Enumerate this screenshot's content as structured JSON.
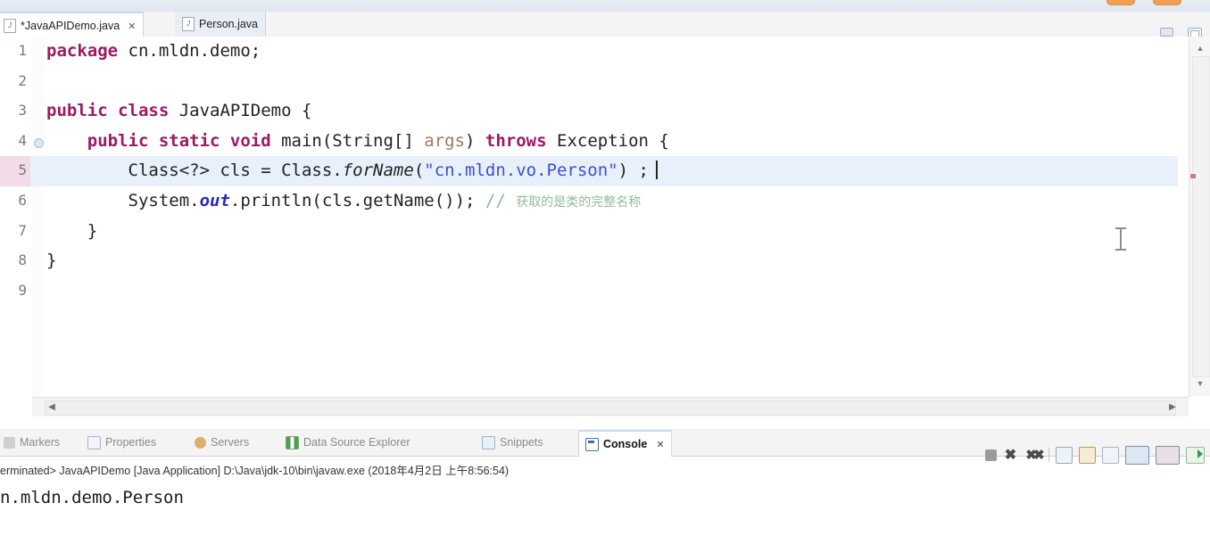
{
  "editor": {
    "tabs": [
      {
        "label": "*JavaAPIDemo.java",
        "active": true,
        "close": "✕"
      },
      {
        "label": "Person.java",
        "active": false,
        "icon": "java-file-icon"
      }
    ],
    "lines": [
      {
        "num": "1",
        "html": "<span class=\"kw\">package</span> cn.mldn.demo;"
      },
      {
        "num": "2",
        "html": ""
      },
      {
        "num": "3",
        "html": "<span class=\"kw\">public class</span> JavaAPIDemo {"
      },
      {
        "num": "4",
        "html": "    <span class=\"kw\">public static void</span> main(String[] <span class=\"par\">args</span>) <span class=\"kw\">throws</span> Exception {"
      },
      {
        "num": "5",
        "html": "        Class&lt;?&gt; cls = Class.<span class=\"ital\">forName</span>(<span class=\"str\">\"cn.mldn.vo.Person\"</span>) ;<span class=\"caret\"></span>"
      },
      {
        "num": "6",
        "html": "        System.<span class=\"fld\">out</span>.println(cls.getName()); <span class=\"cmt\">// </span><span class=\"cn-cmt\">获取的是类的完整名称</span>"
      },
      {
        "num": "7",
        "html": "    }"
      },
      {
        "num": "8",
        "html": "}"
      },
      {
        "num": "9",
        "html": ""
      }
    ],
    "plain_lines": [
      "package cn.mldn.demo;",
      "",
      "public class JavaAPIDemo {",
      "    public static void main(String[] args) throws Exception {",
      "        Class<?> cls = Class.forName(\"cn.mldn.vo.Person\") ;",
      "        System.out.println(cls.getName()); // 获取的是类的完整名称",
      "    }",
      "}",
      ""
    ],
    "current_line": "5",
    "fold_marker_line": "4"
  },
  "bottom_panel": {
    "tabs": [
      {
        "label": "Markers",
        "icon": "markers-icon"
      },
      {
        "label": "Properties",
        "icon": "properties-icon"
      },
      {
        "label": "Servers",
        "icon": "servers-icon"
      },
      {
        "label": "Data Source Explorer",
        "icon": "data-source-explorer-icon"
      },
      {
        "label": "Snippets",
        "icon": "snippets-icon"
      },
      {
        "label": "Console",
        "icon": "console-icon",
        "active": true,
        "close": "✕"
      }
    ],
    "console_header": "erminated> JavaAPIDemo [Java Application] D:\\Java\\jdk-10\\bin\\javaw.exe (2018年4月2日 上午8:56:54)",
    "console_output": "n.mldn.demo.Person",
    "toolbar_icons": [
      "stop-icon",
      "terminate-icon",
      "remove-all-terminated-icon",
      "open-console-icon",
      "scroll-lock-icon",
      "clear-console-icon",
      "pin-console-icon",
      "display-selected-console-icon",
      "open-console-options-icon"
    ]
  },
  "scrollbars": {
    "v_up": "▲",
    "v_down": "▼",
    "h_left": "◀",
    "h_right": "▶"
  },
  "colors": {
    "keyword": "#9c1a63",
    "string": "#3b4ed8",
    "comment": "#8fb89a",
    "field": "#2b2bc4",
    "parameter": "#9d7a5e",
    "current_line_bg": "#e8f1fb",
    "gutter_highlight": "#f3dbe8"
  }
}
